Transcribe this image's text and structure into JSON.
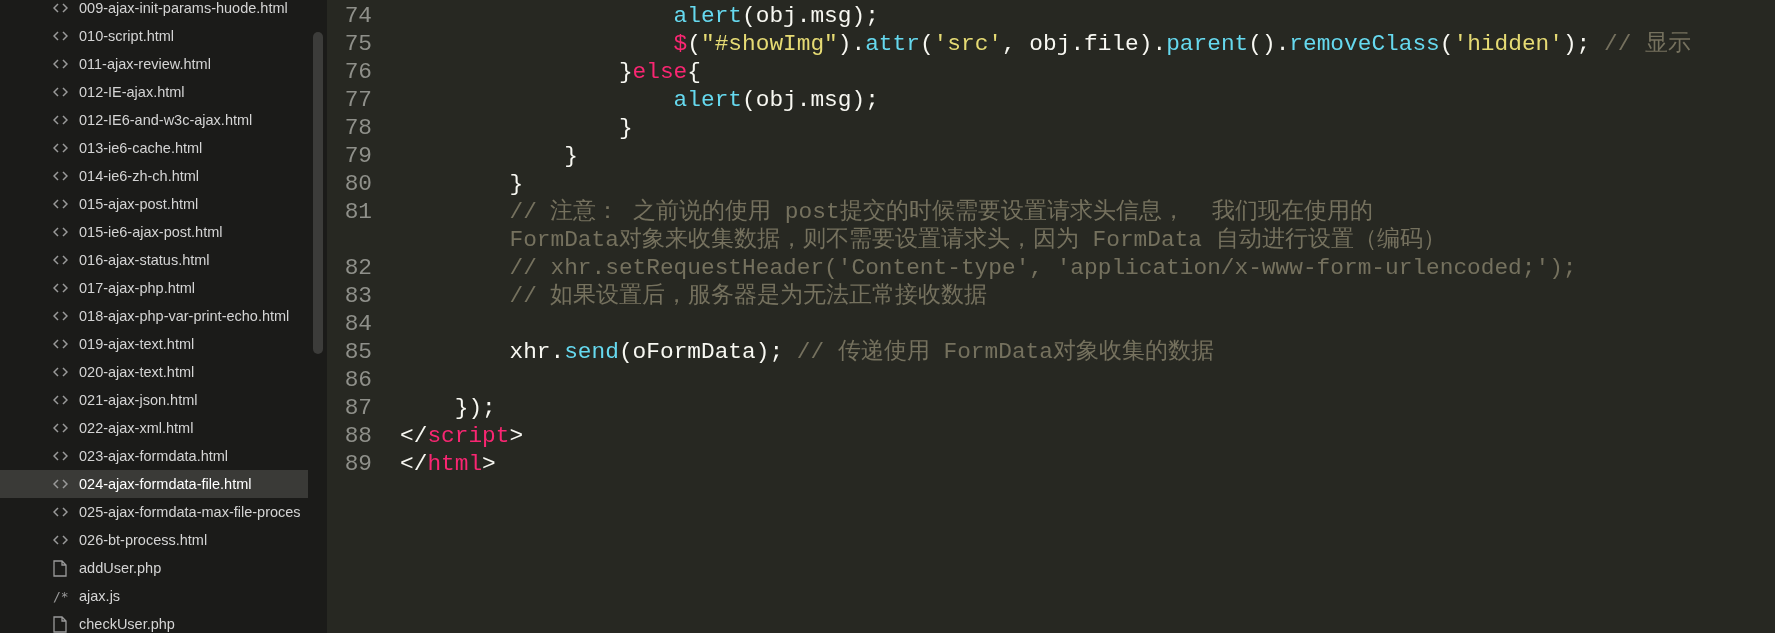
{
  "sidebar": {
    "items": [
      {
        "label": "009-ajax-init-params-huode.html",
        "kind": "html",
        "selected": false
      },
      {
        "label": "010-script.html",
        "kind": "html",
        "selected": false
      },
      {
        "label": "011-ajax-review.html",
        "kind": "html",
        "selected": false
      },
      {
        "label": "012-IE-ajax.html",
        "kind": "html",
        "selected": false
      },
      {
        "label": "012-IE6-and-w3c-ajax.html",
        "kind": "html",
        "selected": false
      },
      {
        "label": "013-ie6-cache.html",
        "kind": "html",
        "selected": false
      },
      {
        "label": "014-ie6-zh-ch.html",
        "kind": "html",
        "selected": false
      },
      {
        "label": "015-ajax-post.html",
        "kind": "html",
        "selected": false
      },
      {
        "label": "015-ie6-ajax-post.html",
        "kind": "html",
        "selected": false
      },
      {
        "label": "016-ajax-status.html",
        "kind": "html",
        "selected": false
      },
      {
        "label": "017-ajax-php.html",
        "kind": "html",
        "selected": false
      },
      {
        "label": "018-ajax-php-var-print-echo.html",
        "kind": "html",
        "selected": false
      },
      {
        "label": "019-ajax-text.html",
        "kind": "html",
        "selected": false
      },
      {
        "label": "020-ajax-text.html",
        "kind": "html",
        "selected": false
      },
      {
        "label": "021-ajax-json.html",
        "kind": "html",
        "selected": false
      },
      {
        "label": "022-ajax-xml.html",
        "kind": "html",
        "selected": false
      },
      {
        "label": "023-ajax-formdata.html",
        "kind": "html",
        "selected": false
      },
      {
        "label": "024-ajax-formdata-file.html",
        "kind": "html",
        "selected": true
      },
      {
        "label": "025-ajax-formdata-max-file-proces",
        "kind": "html",
        "selected": false
      },
      {
        "label": "026-bt-process.html",
        "kind": "html",
        "selected": false
      },
      {
        "label": "addUser.php",
        "kind": "file",
        "selected": false
      },
      {
        "label": "ajax.js",
        "kind": "js",
        "icon": "/*",
        "selected": false
      },
      {
        "label": "checkUser.php",
        "kind": "file",
        "selected": false
      }
    ]
  },
  "editor": {
    "lines": [
      {
        "number": "74",
        "tokens": [
          {
            "kind": "func",
            "text": "                    alert"
          },
          {
            "kind": "plain",
            "text": "(obj.msg);"
          }
        ]
      },
      {
        "number": "75",
        "tokens": [
          {
            "kind": "keyword",
            "text": "                    $"
          },
          {
            "kind": "plain",
            "text": "("
          },
          {
            "kind": "string",
            "text": "\"#showImg\""
          },
          {
            "kind": "plain",
            "text": ")."
          },
          {
            "kind": "func",
            "text": "attr"
          },
          {
            "kind": "plain",
            "text": "("
          },
          {
            "kind": "string",
            "text": "'src'"
          },
          {
            "kind": "plain",
            "text": ", obj.file)."
          },
          {
            "kind": "func",
            "text": "parent"
          },
          {
            "kind": "plain",
            "text": "()."
          },
          {
            "kind": "func",
            "text": "removeClass"
          },
          {
            "kind": "plain",
            "text": "("
          },
          {
            "kind": "string",
            "text": "'hidden'"
          },
          {
            "kind": "plain",
            "text": "); "
          },
          {
            "kind": "comment",
            "text": "// 显示"
          }
        ]
      },
      {
        "number": "76",
        "tokens": [
          {
            "kind": "plain",
            "text": "                }"
          },
          {
            "kind": "keyword",
            "text": "else"
          },
          {
            "kind": "plain",
            "text": "{"
          }
        ]
      },
      {
        "number": "77",
        "tokens": [
          {
            "kind": "func",
            "text": "                    alert"
          },
          {
            "kind": "plain",
            "text": "(obj.msg);"
          }
        ]
      },
      {
        "number": "78",
        "tokens": [
          {
            "kind": "plain",
            "text": "                }"
          }
        ]
      },
      {
        "number": "79",
        "tokens": [
          {
            "kind": "plain",
            "text": "            }"
          }
        ]
      },
      {
        "number": "80",
        "tokens": [
          {
            "kind": "plain",
            "text": "        }"
          }
        ]
      },
      {
        "number": "81",
        "tokens": [
          {
            "kind": "comment",
            "text": "        // 注意： 之前说的使用 post提交的时候需要设置请求头信息，  我们现在使用的"
          }
        ]
      },
      {
        "tokens": [
          {
            "kind": "comment",
            "text": "        FormData对象来收集数据，则不需要设置请求头，因为 FormData 自动进行设置（编码）"
          }
        ]
      },
      {
        "number": "82",
        "tokens": [
          {
            "kind": "comment",
            "text": "        // xhr.setRequestHeader('Content-type', 'application/x-www-form-urlencoded;');"
          }
        ]
      },
      {
        "number": "83",
        "tokens": [
          {
            "kind": "comment",
            "text": "        // 如果设置后，服务器是为无法正常接收数据"
          }
        ]
      },
      {
        "number": "84"
      },
      {
        "number": "85",
        "tokens": [
          {
            "kind": "plain",
            "text": "        xhr."
          },
          {
            "kind": "func",
            "text": "send"
          },
          {
            "kind": "plain",
            "text": "(oFormData); "
          },
          {
            "kind": "comment",
            "text": "// 传递使用 FormData对象收集的数据"
          }
        ]
      },
      {
        "number": "86"
      },
      {
        "number": "87",
        "tokens": [
          {
            "kind": "plain",
            "text": "    });"
          }
        ]
      },
      {
        "number": "88",
        "tokens": [
          {
            "kind": "plain",
            "text": "</"
          },
          {
            "kind": "keyword",
            "text": "script"
          },
          {
            "kind": "plain",
            "text": ">"
          }
        ]
      },
      {
        "number": "89",
        "tokens": [
          {
            "kind": "plain",
            "text": "</"
          },
          {
            "kind": "keyword",
            "text": "html"
          },
          {
            "kind": "plain",
            "text": ">"
          }
        ]
      }
    ]
  }
}
